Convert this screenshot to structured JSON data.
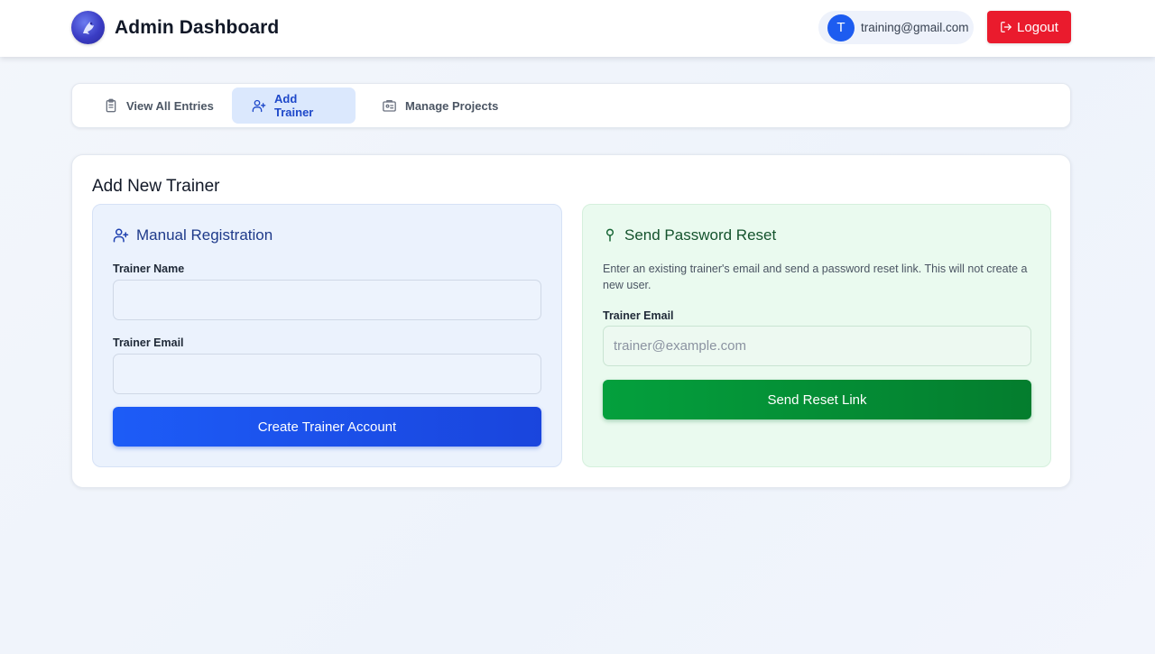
{
  "header": {
    "title": "Admin Dashboard",
    "user": {
      "avatar_letter": "T",
      "email": "training@gmail.com"
    },
    "logout_label": "Logout"
  },
  "tabs": [
    {
      "label": "View All Entries",
      "icon": "clipboard-icon",
      "active": false
    },
    {
      "label": "Add Trainer",
      "icon": "user-plus-icon",
      "active": true
    },
    {
      "label": "Manage Projects",
      "icon": "id-card-icon",
      "active": false
    }
  ],
  "main": {
    "title": "Add New Trainer",
    "manual": {
      "heading": "Manual Registration",
      "name_label": "Trainer Name",
      "name_value": "",
      "email_label": "Trainer Email",
      "email_value": "",
      "submit_label": "Create Trainer Account"
    },
    "reset": {
      "heading": "Send Password Reset",
      "description": "Enter an existing trainer's email and send a password reset link. This will not create a new user.",
      "email_label": "Trainer Email",
      "email_placeholder": "trainer@example.com",
      "email_value": "",
      "submit_label": "Send Reset Link"
    }
  },
  "colors": {
    "primary_blue": "#1d5cf7",
    "logout_red": "#ea1b2d",
    "success_green": "#04a03d",
    "active_tab_bg": "#dbe8fd"
  }
}
